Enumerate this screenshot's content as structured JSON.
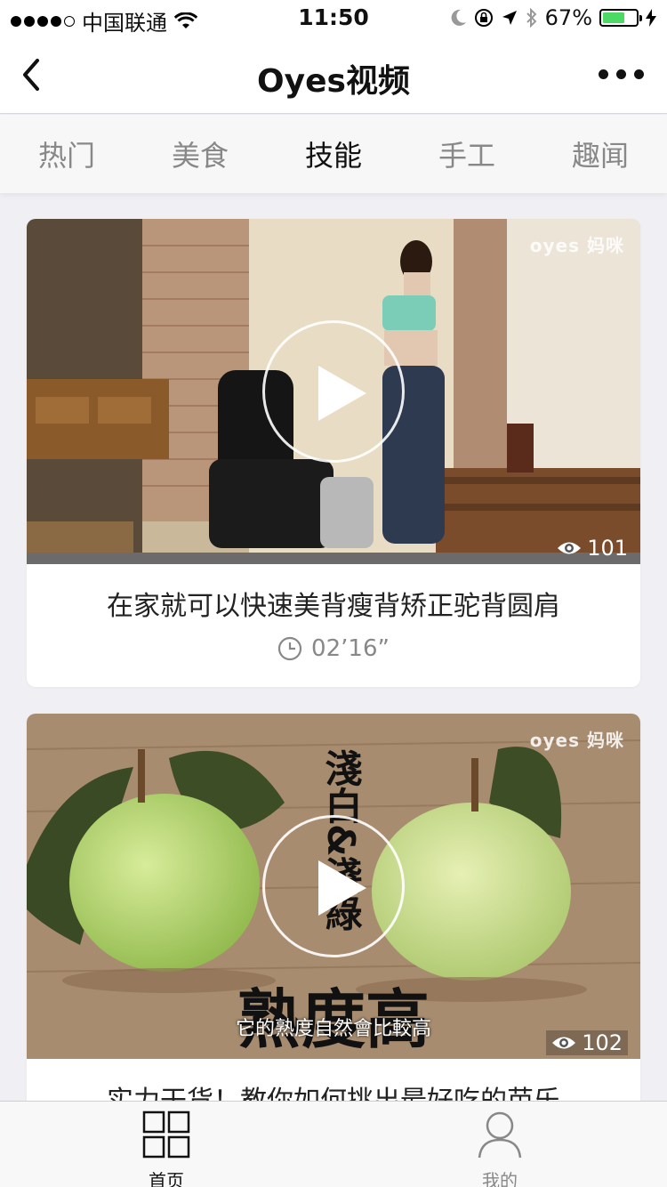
{
  "status": {
    "carrier": "中国联通",
    "time": "11:50",
    "battery": "67%",
    "battery_level": 0.67,
    "signal_dots": 5,
    "signal_filled": 4
  },
  "nav": {
    "title": "Oyes视频"
  },
  "tabs": [
    {
      "label": "热门"
    },
    {
      "label": "美食"
    },
    {
      "label": "技能"
    },
    {
      "label": "手工"
    },
    {
      "label": "趣闻"
    }
  ],
  "active_tab": "技能",
  "cards": [
    {
      "title": "在家就可以快速美背瘦背矫正驼背圆肩",
      "duration": "02’16”",
      "views": "101",
      "brand": "oyes 妈咪"
    },
    {
      "title": "实力干货！教你如何挑出最好吃的芭乐",
      "duration": "",
      "views": "102",
      "brand": "oyes 妈咪",
      "overlay_text_vertical": "淺白&淺綠",
      "overlay_text_big": "熟度高",
      "overlay_subtitle": "它的熟度自然會比較高"
    }
  ],
  "tabbar": {
    "home_label": "首页",
    "mine_label": "我的"
  },
  "colors": {
    "accent_battery": "#4cd964",
    "background": "#efeff4"
  }
}
